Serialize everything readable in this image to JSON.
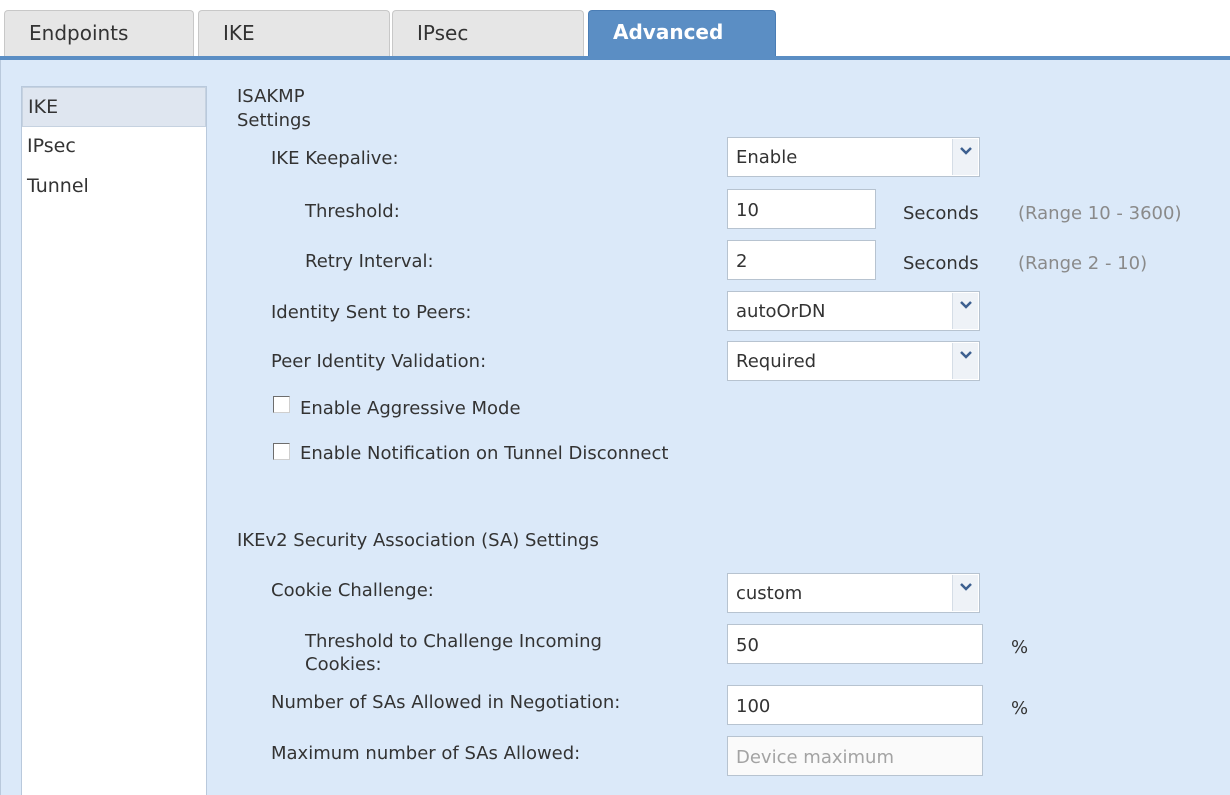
{
  "tabs": [
    {
      "label": "Endpoints",
      "active": false
    },
    {
      "label": "IKE",
      "active": false
    },
    {
      "label": "IPsec",
      "active": false
    },
    {
      "label": "Advanced",
      "active": true
    }
  ],
  "sidebar": {
    "items": [
      {
        "label": "IKE",
        "selected": true
      },
      {
        "label": "IPsec",
        "selected": false
      },
      {
        "label": "Tunnel",
        "selected": false
      }
    ]
  },
  "isakmp": {
    "heading": "ISAKMP\nSettings",
    "ike_keepalive": {
      "label": "IKE Keepalive:",
      "value": "Enable"
    },
    "threshold": {
      "label": "Threshold:",
      "value": "10",
      "unit": "Seconds",
      "range": "(Range 10 - 3600)"
    },
    "retry_interval": {
      "label": "Retry Interval:",
      "value": "2",
      "unit": "Seconds",
      "range": "(Range 2 - 10)"
    },
    "identity_sent": {
      "label": "Identity Sent to Peers:",
      "value": "autoOrDN"
    },
    "peer_validation": {
      "label": "Peer Identity Validation:",
      "value": "Required"
    },
    "aggressive_mode": {
      "label": "Enable Aggressive Mode",
      "checked": false
    },
    "notify_disconnect": {
      "label": "Enable Notification on Tunnel Disconnect",
      "checked": false
    }
  },
  "ikev2": {
    "heading": "IKEv2 Security Association (SA) Settings",
    "cookie_challenge": {
      "label": "Cookie Challenge:",
      "value": "custom"
    },
    "threshold_cookies": {
      "label": "Threshold to Challenge Incoming\nCookies:",
      "value": "50",
      "unit": "%"
    },
    "sas_negotiation": {
      "label": "Number of SAs Allowed in Negotiation:",
      "value": "100",
      "unit": "%"
    },
    "max_sas": {
      "label": "Maximum number of SAs Allowed:",
      "placeholder": "Device maximum"
    }
  },
  "colors": {
    "accent": "#5b8ec4",
    "panel": "#dbe9f9"
  }
}
